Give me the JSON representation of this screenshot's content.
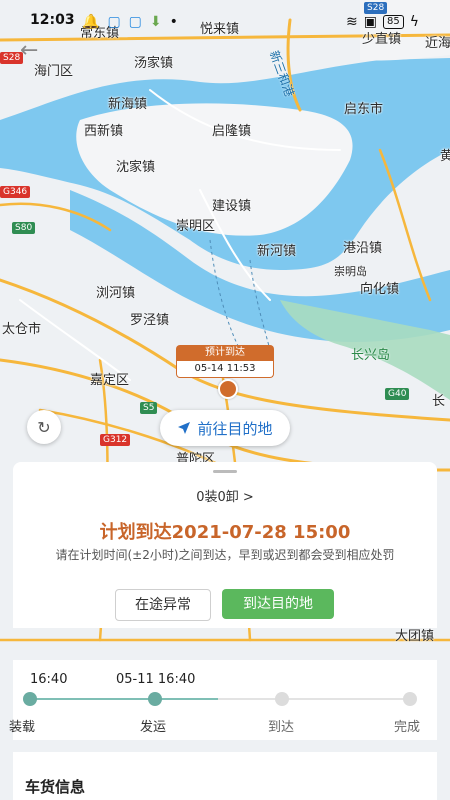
{
  "status_bar": {
    "time": "12:03",
    "battery": "85"
  },
  "map": {
    "places": [
      {
        "text": "常东镇"
      },
      {
        "text": "悦来镇"
      },
      {
        "text": "少直镇"
      },
      {
        "text": "近海"
      },
      {
        "text": "海门区"
      },
      {
        "text": "汤家镇"
      },
      {
        "text": "新海镇"
      },
      {
        "text": "启东市"
      },
      {
        "text": "西新镇"
      },
      {
        "text": "启隆镇"
      },
      {
        "text": "沈家镇"
      },
      {
        "text": "建设镇"
      },
      {
        "text": "崇明区"
      },
      {
        "text": "新河镇"
      },
      {
        "text": "港沿镇"
      },
      {
        "text": "崇明岛"
      },
      {
        "text": "向化镇"
      },
      {
        "text": "浏河镇"
      },
      {
        "text": "太仓市"
      },
      {
        "text": "罗泾镇"
      },
      {
        "text": "长兴岛"
      },
      {
        "text": "嘉定区"
      },
      {
        "text": "普陀区"
      },
      {
        "text": "大团镇"
      },
      {
        "text": "长"
      },
      {
        "text": "黄"
      }
    ],
    "route_labels": [
      "新三和港"
    ],
    "road_shields": [
      {
        "text": "S28"
      },
      {
        "text": "G346"
      },
      {
        "text": "S80"
      },
      {
        "text": "S5"
      },
      {
        "text": "G312"
      },
      {
        "text": "G40"
      },
      {
        "text": "S28"
      }
    ],
    "marker": {
      "head": "预计到达",
      "time": "05-14 11:53"
    }
  },
  "actions": {
    "navigate_label": "前往目的地"
  },
  "sheet": {
    "loads": "0装0卸 >",
    "plan_arrival": "计划到达2021-07-28 15:00",
    "note": "请在计划时间(±2小时)之间到达，早到或迟到都会受到相应处罚",
    "exception_button": "在途异常",
    "arrive_button": "到达目的地"
  },
  "timeline": {
    "times": [
      "16:40",
      "05-11 16:40"
    ],
    "stages": [
      {
        "label": "装载",
        "done": true
      },
      {
        "label": "发运",
        "done": true
      },
      {
        "label": "到达",
        "done": false
      },
      {
        "label": "完成",
        "done": false
      }
    ]
  },
  "cargo": {
    "title": "车货信息"
  },
  "colors": {
    "accent_orange": "#c8652a",
    "accent_blue": "#2170c8",
    "accent_green": "#5bb85d",
    "water": "#7ec8ef"
  }
}
